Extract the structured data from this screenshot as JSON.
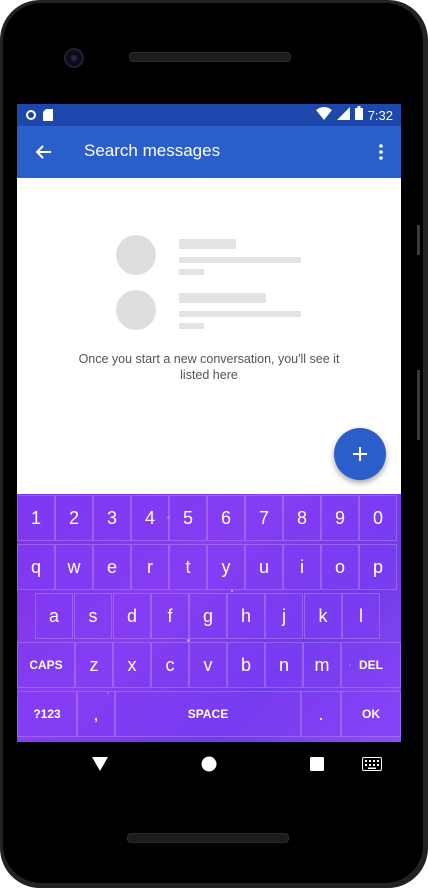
{
  "status_bar": {
    "time": "7:32",
    "icons": [
      "sync-icon",
      "sd-card-icon",
      "wifi-icon",
      "signal-icon",
      "battery-icon"
    ]
  },
  "app_bar": {
    "title": "Search messages",
    "back_icon": "arrow-back-icon",
    "menu_icon": "more-vert-icon"
  },
  "empty_state": {
    "message": "Once you start a new conversation, you'll see it listed here"
  },
  "fab": {
    "icon": "plus-icon"
  },
  "keyboard": {
    "rows": [
      [
        "1",
        "2",
        "3",
        "4",
        "5",
        "6",
        "7",
        "8",
        "9",
        "0"
      ],
      [
        "q",
        "w",
        "e",
        "r",
        "t",
        "y",
        "u",
        "i",
        "o",
        "p"
      ],
      [
        "a",
        "s",
        "d",
        "f",
        "g",
        "h",
        "j",
        "k",
        "l"
      ],
      [
        "CAPS",
        "z",
        "x",
        "c",
        "v",
        "b",
        "n",
        "m",
        "DEL"
      ],
      [
        "?123",
        ",",
        "SPACE",
        ".",
        "OK"
      ]
    ]
  },
  "navigation": {
    "icons": [
      "back-triangle-icon",
      "home-circle-icon",
      "recents-square-icon",
      "keyboard-icon"
    ]
  },
  "colors": {
    "status_bar": "#1d47ab",
    "app_bar": "#2a5fc9",
    "fab": "#2b5ec8",
    "keyboard": "#7a33ea"
  }
}
